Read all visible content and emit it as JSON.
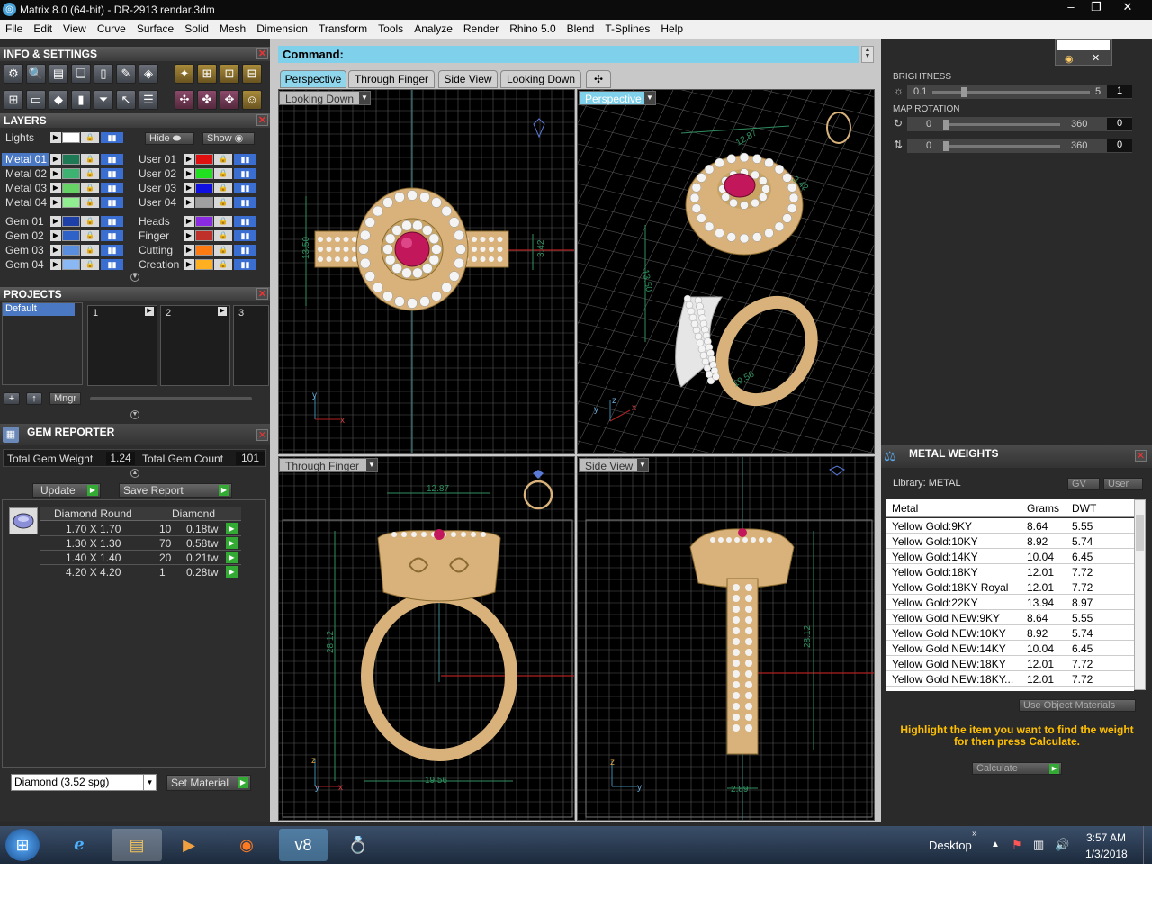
{
  "window": {
    "title": "Matrix 8.0 (64-bit) - DR-2913 rendar.3dm",
    "app_icon": "matrix-icon"
  },
  "menu": [
    "File",
    "Edit",
    "View",
    "Curve",
    "Surface",
    "Solid",
    "Mesh",
    "Dimension",
    "Transform",
    "Tools",
    "Analyze",
    "Render",
    "Rhino 5.0",
    "Blend",
    "T-Splines",
    "Help"
  ],
  "info_settings": {
    "title": "INFO & SETTINGS"
  },
  "layers": {
    "title": "LAYERS",
    "lights_label": "Lights",
    "hide_label": "Hide",
    "show_label": "Show",
    "left": [
      {
        "name": "Metal 01",
        "color": "#1e7a55"
      },
      {
        "name": "Metal 02",
        "color": "#3cb371"
      },
      {
        "name": "Metal 03",
        "color": "#66d266"
      },
      {
        "name": "Metal 04",
        "color": "#90ee90"
      },
      {
        "name": "Gem 01",
        "color": "#1c3fa8"
      },
      {
        "name": "Gem 02",
        "color": "#2f62c8"
      },
      {
        "name": "Gem 03",
        "color": "#5a8fe0"
      },
      {
        "name": "Gem 04",
        "color": "#8ab8f5"
      }
    ],
    "right": [
      {
        "name": "User 01",
        "color": "#e01010"
      },
      {
        "name": "User 02",
        "color": "#20e020"
      },
      {
        "name": "User 03",
        "color": "#1010e0"
      },
      {
        "name": "User 04",
        "color": "#a0a0a0"
      },
      {
        "name": "Heads",
        "color": "#8a2be2"
      },
      {
        "name": "Finger",
        "color": "#c0302a"
      },
      {
        "name": "Cutting",
        "color": "#ff7a10"
      },
      {
        "name": "Creation",
        "color": "#ffb020"
      }
    ]
  },
  "projects": {
    "title": "PROJECTS",
    "default_label": "Default",
    "slots": [
      "1",
      "2",
      "3"
    ],
    "mngr_label": "Mngr"
  },
  "gem_reporter": {
    "title": "GEM REPORTER",
    "total_weight_label": "Total Gem Weight",
    "total_weight": "1.24",
    "total_count_label": "Total Gem Count",
    "total_count": "101",
    "update_label": "Update",
    "save_report_label": "Save Report",
    "col_shape": "Diamond Round",
    "col_material": "Diamond",
    "rows": [
      {
        "size": "1.70 X 1.70",
        "count": "10",
        "weight": "0.18tw"
      },
      {
        "size": "1.30 X 1.30",
        "count": "70",
        "weight": "0.58tw"
      },
      {
        "size": "1.40 X 1.40",
        "count": "20",
        "weight": "0.21tw"
      },
      {
        "size": "4.20 X 4.20",
        "count": "1",
        "weight": "0.28tw"
      }
    ],
    "material_select": "Diamond     (3.52 spg)",
    "set_material_label": "Set Material"
  },
  "command": {
    "label": "Command:"
  },
  "tabs": [
    "Perspective",
    "Through Finger",
    "Side View",
    "Looking Down"
  ],
  "viewports": {
    "top_left": {
      "label": "Looking Down",
      "dims": [
        "13.50",
        "3.42"
      ],
      "axis1": "y",
      "axis2": "x"
    },
    "top_right": {
      "label": "Perspective",
      "dims": [
        "12.87",
        "3.42",
        "13.50",
        "19.56"
      ],
      "axis1": "z",
      "axis2": "y",
      "axis3": "x"
    },
    "bottom_left": {
      "label": "Through Finger",
      "dims": [
        "12.87",
        "28.12",
        "19.56"
      ],
      "axis1": "z",
      "axis2": "y",
      "axis3": "x"
    },
    "bottom_right": {
      "label": "Side View",
      "dims": [
        "28.12",
        "2.89"
      ],
      "axis1": "z",
      "axis2": "y"
    }
  },
  "display": {
    "brightness_label": "BRIGHTNESS",
    "brightness_min": "0.1",
    "brightness_max": "5",
    "brightness_value": "1",
    "map_rotation_label": "MAP ROTATION",
    "rot_rows": [
      {
        "min": "0",
        "max": "360",
        "value": "0"
      },
      {
        "min": "0",
        "max": "360",
        "value": "0"
      }
    ]
  },
  "metal_weights": {
    "title": "METAL WEIGHTS",
    "library_label": "Library: METAL",
    "gv_label": "GV",
    "user_label": "User",
    "headers": [
      "Metal",
      "Grams",
      "DWT"
    ],
    "rows": [
      {
        "metal": "Yellow Gold:9KY",
        "grams": "8.64",
        "dwt": "5.55"
      },
      {
        "metal": "Yellow Gold:10KY",
        "grams": "8.92",
        "dwt": "5.74"
      },
      {
        "metal": "Yellow Gold:14KY",
        "grams": "10.04",
        "dwt": "6.45"
      },
      {
        "metal": "Yellow Gold:18KY",
        "grams": "12.01",
        "dwt": "7.72"
      },
      {
        "metal": "Yellow Gold:18KY Royal",
        "grams": "12.01",
        "dwt": "7.72"
      },
      {
        "metal": "Yellow Gold:22KY",
        "grams": "13.94",
        "dwt": "8.97"
      },
      {
        "metal": "Yellow Gold NEW:9KY",
        "grams": "8.64",
        "dwt": "5.55"
      },
      {
        "metal": "Yellow Gold NEW:10KY",
        "grams": "8.92",
        "dwt": "5.74"
      },
      {
        "metal": "Yellow Gold NEW:14KY",
        "grams": "10.04",
        "dwt": "6.45"
      },
      {
        "metal": "Yellow Gold NEW:18KY",
        "grams": "12.01",
        "dwt": "7.72"
      },
      {
        "metal": "Yellow Gold NEW:18KY...",
        "grams": "12.01",
        "dwt": "7.72"
      }
    ],
    "use_object_materials": "Use Object Materials",
    "hint": "Highlight the item you want to find the weight for then press Calculate.",
    "calculate_label": "Calculate"
  },
  "taskbar": {
    "desktop_label": "Desktop",
    "time": "3:57 AM",
    "date": "1/3/2018",
    "app_icons": [
      "windows-start-icon",
      "internet-explorer-icon",
      "file-explorer-icon",
      "media-player-icon",
      "firefox-icon",
      "matrix-v8-icon",
      "gem-app-icon"
    ]
  },
  "colors": {
    "accent": "#8fd5ec",
    "metal": "#d8b27a",
    "gem": "#c2185b",
    "grid": "#555555",
    "dim": "#2f8f5f"
  }
}
